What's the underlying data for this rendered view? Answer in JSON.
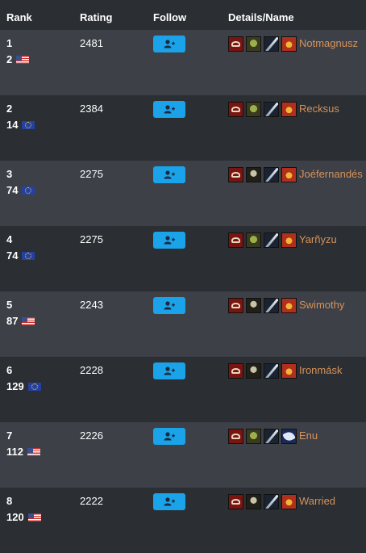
{
  "header": {
    "rank": "Rank",
    "rating": "Rating",
    "follow": "Follow",
    "details": "Details/Name"
  },
  "rows": [
    {
      "rank": "1",
      "sub": "2",
      "region": "US",
      "rating": "2481",
      "name": "Notmagnusz",
      "race": "orc",
      "spec": "spec",
      "class": "warrior"
    },
    {
      "rank": "2",
      "sub": "14",
      "region": "EU",
      "rating": "2384",
      "name": "Recksus",
      "race": "orc",
      "spec": "spec",
      "class": "warrior"
    },
    {
      "rank": "3",
      "sub": "74",
      "region": "EU",
      "rating": "2275",
      "name": "Joéfernandés",
      "race": "undead",
      "spec": "spec",
      "class": "warrior"
    },
    {
      "rank": "4",
      "sub": "74",
      "region": "EU",
      "rating": "2275",
      "name": "Yarñyzu",
      "race": "orc",
      "spec": "spec",
      "class": "warrior"
    },
    {
      "rank": "5",
      "sub": "87",
      "region": "US",
      "rating": "2243",
      "name": "Swimothy",
      "race": "undead",
      "spec": "spec",
      "class": "warrior"
    },
    {
      "rank": "6",
      "sub": "129",
      "region": "EU",
      "rating": "2228",
      "name": "Ironmásk",
      "race": "undead",
      "spec": "spec",
      "class": "warrior"
    },
    {
      "rank": "7",
      "sub": "112",
      "region": "US",
      "rating": "2226",
      "name": "Enu",
      "race": "orc",
      "spec": "spec",
      "class": "warrior2"
    },
    {
      "rank": "8",
      "sub": "120",
      "region": "US",
      "rating": "2222",
      "name": "Warried",
      "race": "undead",
      "spec": "spec",
      "class": "warrior"
    }
  ],
  "icons": {
    "faction": "horde-icon",
    "follow": "add-user-icon"
  },
  "colors": {
    "follow_button": "#1aa3e8",
    "name": "#d6925a",
    "row_alt": "#3d4047",
    "background": "#2b2e33"
  }
}
